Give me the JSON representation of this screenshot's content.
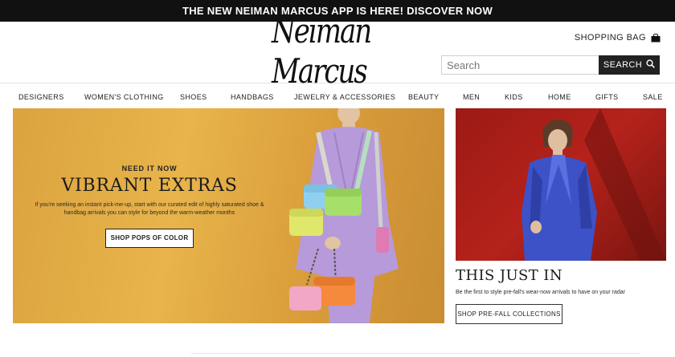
{
  "promo": {
    "text": "THE NEW NEIMAN MARCUS APP IS HERE! DISCOVER NOW"
  },
  "header": {
    "logo_text": "Neiman Marcus",
    "bag_label": "SHOPPING BAG",
    "bag_icon": "shopping-bag-icon",
    "search": {
      "placeholder": "Search",
      "button_label": "SEARCH",
      "icon": "search-icon"
    }
  },
  "nav": {
    "items": [
      {
        "label": "DESIGNERS"
      },
      {
        "label": "WOMEN'S CLOTHING"
      },
      {
        "label": "SHOES"
      },
      {
        "label": "HANDBAGS"
      },
      {
        "label": "JEWELRY & ACCESSORIES"
      },
      {
        "label": "BEAUTY"
      },
      {
        "label": "MEN"
      },
      {
        "label": "KIDS"
      },
      {
        "label": "HOME"
      },
      {
        "label": "GIFTS"
      },
      {
        "label": "SALE"
      }
    ]
  },
  "hero": {
    "eyebrow": "NEED IT NOW",
    "title": "VIBRANT EXTRAS",
    "description": "If you're seeking an instant pick-me-up, start with our curated edit of highly saturated shoe & handbag arrivals you can style for beyond the warm-weather months",
    "button_label": "SHOP POPS OF COLOR",
    "colors": {
      "background": "#e0a943",
      "dress": "#b79ad9",
      "bag_green": "#a6e06a",
      "bag_blue": "#8fd0f0",
      "bag_orange": "#f58a3c",
      "bag_pink": "#f2a7c6"
    }
  },
  "side": {
    "title": "THIS JUST IN",
    "description": "Be the first to style pre-fall's wear-now arrivals to have on your radar",
    "button_label": "SHOP PRE-FALL COLLECTIONS",
    "colors": {
      "background": "#a81d17",
      "suit": "#3d52c7"
    }
  }
}
